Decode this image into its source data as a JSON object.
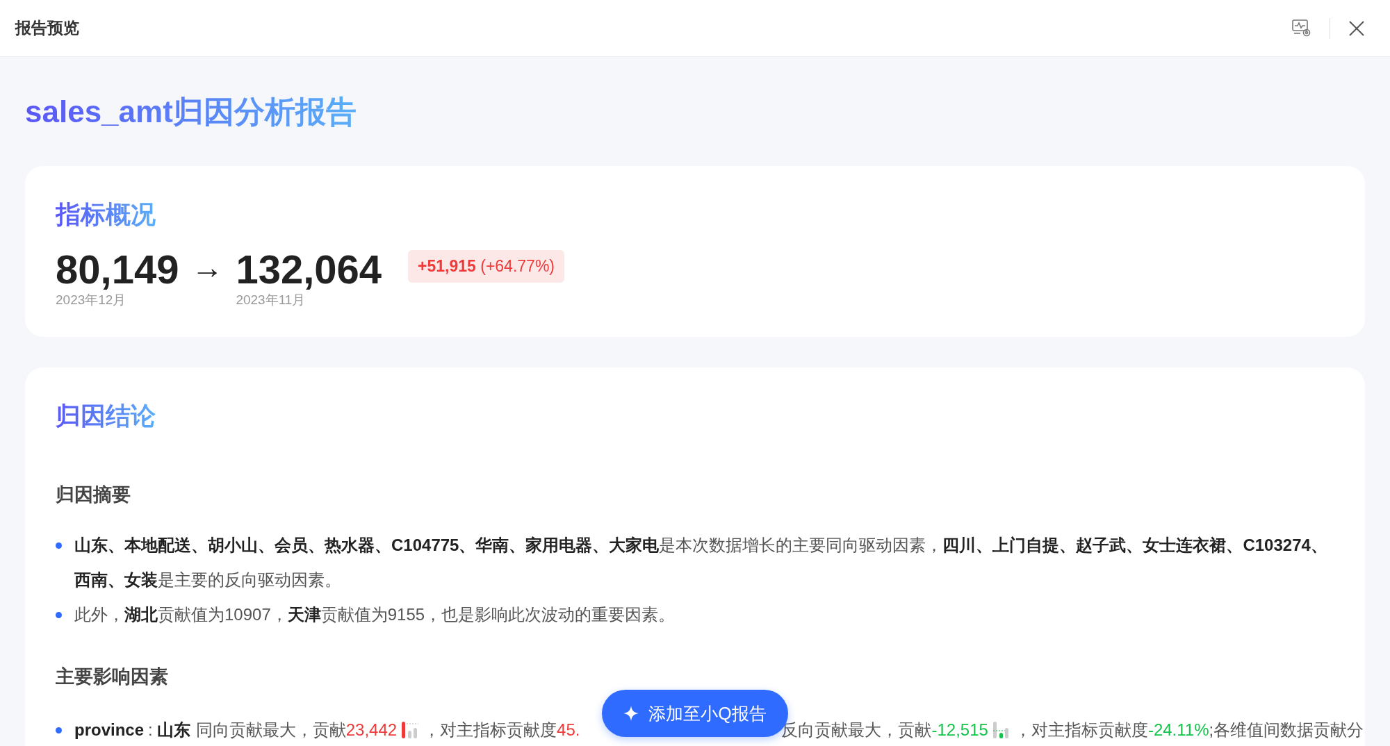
{
  "header": {
    "title": "报告预览"
  },
  "report_title": "sales_amt归因分析报告",
  "overview": {
    "title": "指标概况",
    "current": {
      "value": "80,149",
      "period": "2023年12月"
    },
    "arrow": "→",
    "previous": {
      "value": "132,064",
      "period": "2023年11月"
    },
    "change": {
      "amount": "+51,915",
      "percent": "(+64.77%)"
    }
  },
  "conclusion": {
    "title": "归因结论",
    "summary_title": "归因摘要",
    "summary": [
      "**山东、本地配送、胡小山、会员、热水器、C104775、华南、家用电器、大家电**是本次数据增长的主要同向驱动因素，**四川、上门自提、赵子武、女士连衣裙、C103274、西南、女装**是主要的反向驱动因素。",
      "此外，**湖北**贡献值为10907，**天津**贡献值为9155，也是影响此次波动的重要因素。"
    ],
    "factors_title": "主要影响因素",
    "factors": [
      [
        {
          "kind": "dimension",
          "text": "province"
        },
        {
          "kind": "colon",
          "text": ":"
        },
        {
          "kind": "bold",
          "text": "山东"
        },
        {
          "kind": "text",
          "text": "同向贡献最大，贡献"
        },
        {
          "kind": "positive",
          "text": "23,442"
        },
        {
          "kind": "bars-up"
        },
        {
          "kind": "text",
          "text": "，对主指标贡献度"
        },
        {
          "kind": "positive",
          "text": "45."
        },
        {
          "kind": "covered"
        },
        {
          "kind": "text",
          "text": "反向贡献最大，贡献"
        },
        {
          "kind": "negative",
          "text": "-12,515"
        },
        {
          "kind": "bars-down"
        },
        {
          "kind": "text",
          "text": "，对主指标贡献度"
        },
        {
          "kind": "negative",
          "text": "-24.11%"
        },
        {
          "kind": "text",
          "text": ";各维值间数据贡献分"
        }
      ]
    ]
  },
  "floating_button": {
    "label": "添加至小Q报告"
  }
}
